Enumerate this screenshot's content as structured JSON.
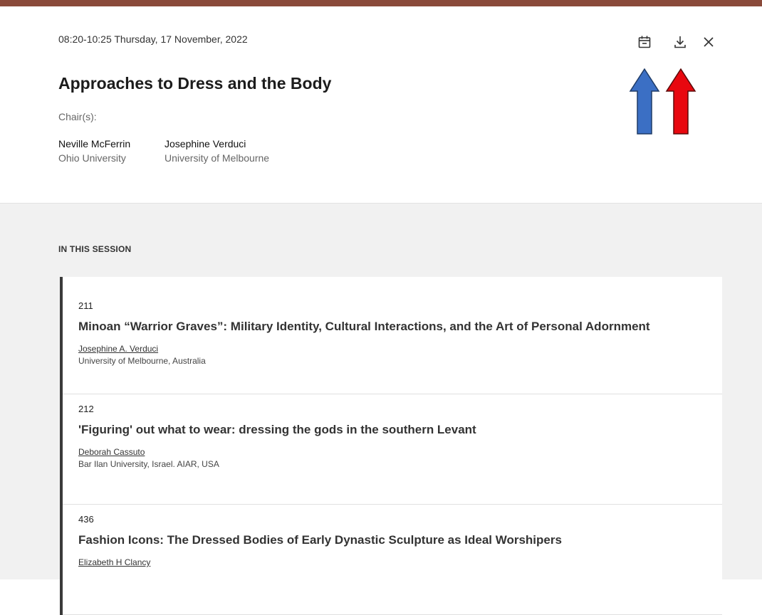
{
  "top_strip_text": "",
  "session": {
    "datetime": "08:20-10:25 Thursday, 17 November, 2022",
    "title": "Approaches to Dress and the Body",
    "chairs_label": "Chair(s):",
    "chairs": [
      {
        "name": "Neville McFerrin",
        "affiliation": "Ohio University"
      },
      {
        "name": "Josephine Verduci",
        "affiliation": "University of Melbourne"
      }
    ]
  },
  "toolbar": {
    "calendar_icon": "calendar-icon",
    "download_icon": "download-icon",
    "close_icon": "close-icon"
  },
  "annotations": {
    "arrow_colors": [
      "#3b6fc4",
      "#e8080f"
    ]
  },
  "list": {
    "section_label": "IN THIS SESSION",
    "items": [
      {
        "number": "211",
        "title": "Minoan “Warrior Graves”: Military Identity, Cultural Interactions, and the Art of Personal Adornment",
        "author": "Josephine A. Verduci",
        "institution": "University of Melbourne, Australia"
      },
      {
        "number": "212",
        "title": "'Figuring' out what to wear: dressing the gods in the southern Levant",
        "author": "Deborah Cassuto",
        "institution": "Bar Ilan University, Israel. AIAR, USA"
      },
      {
        "number": "436",
        "title": "Fashion Icons: The Dressed Bodies of Early Dynastic Sculpture as Ideal Worshipers",
        "author": "Elizabeth H Clancy",
        "institution": ""
      }
    ]
  }
}
